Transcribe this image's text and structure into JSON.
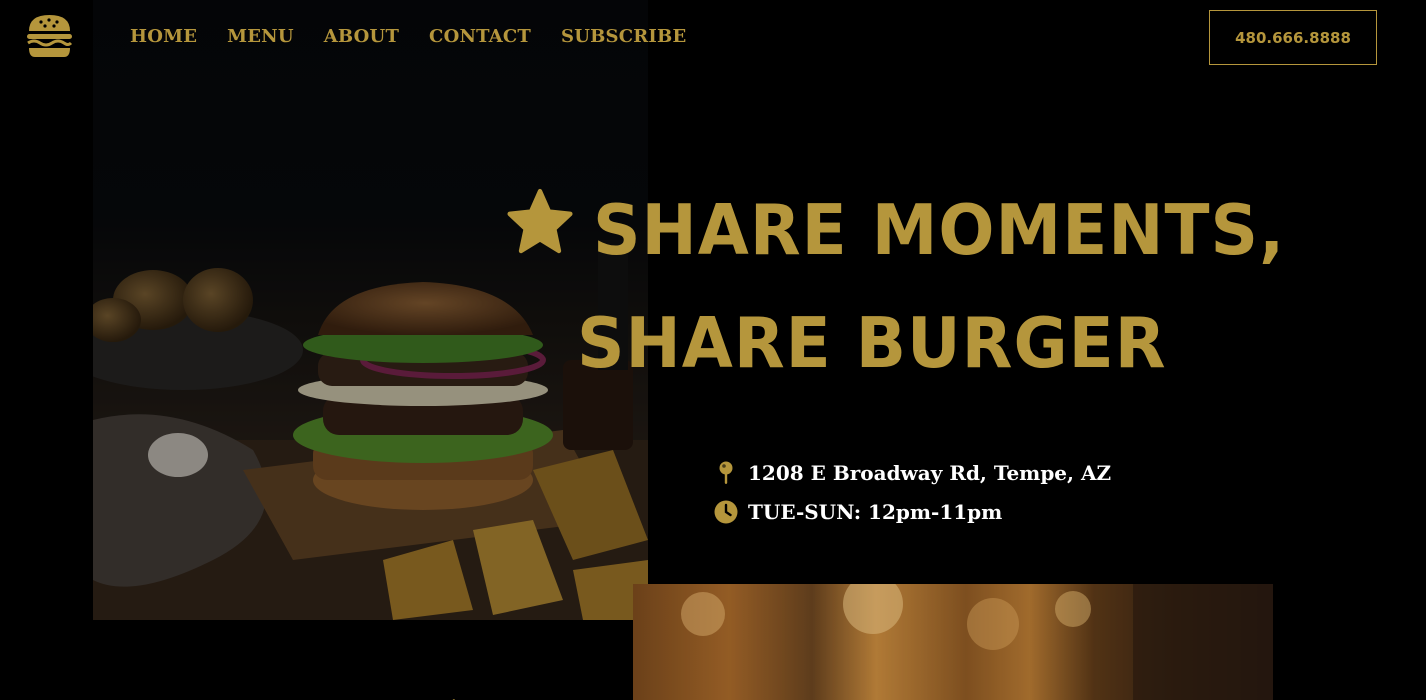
{
  "header": {
    "logo_icon": "burger-icon",
    "nav": [
      {
        "label": "HOME"
      },
      {
        "label": "MENU"
      },
      {
        "label": "ABOUT"
      },
      {
        "label": "CONTACT"
      },
      {
        "label": "SUBSCRIBE"
      }
    ],
    "phone": "480.666.8888"
  },
  "hero": {
    "headline_line1": "SHARE MOMENTS,",
    "headline_line2": "SHARE BURGER",
    "headline_icon": "star-icon",
    "address": "1208 E Broadway Rd, Tempe, AZ",
    "address_icon": "map-pin-icon",
    "hours": "TUE-SUN: 12pm-11pm",
    "hours_icon": "clock-icon"
  },
  "colors": {
    "background": "#000000",
    "accent": "#b5963c",
    "text": "#ffffff"
  }
}
